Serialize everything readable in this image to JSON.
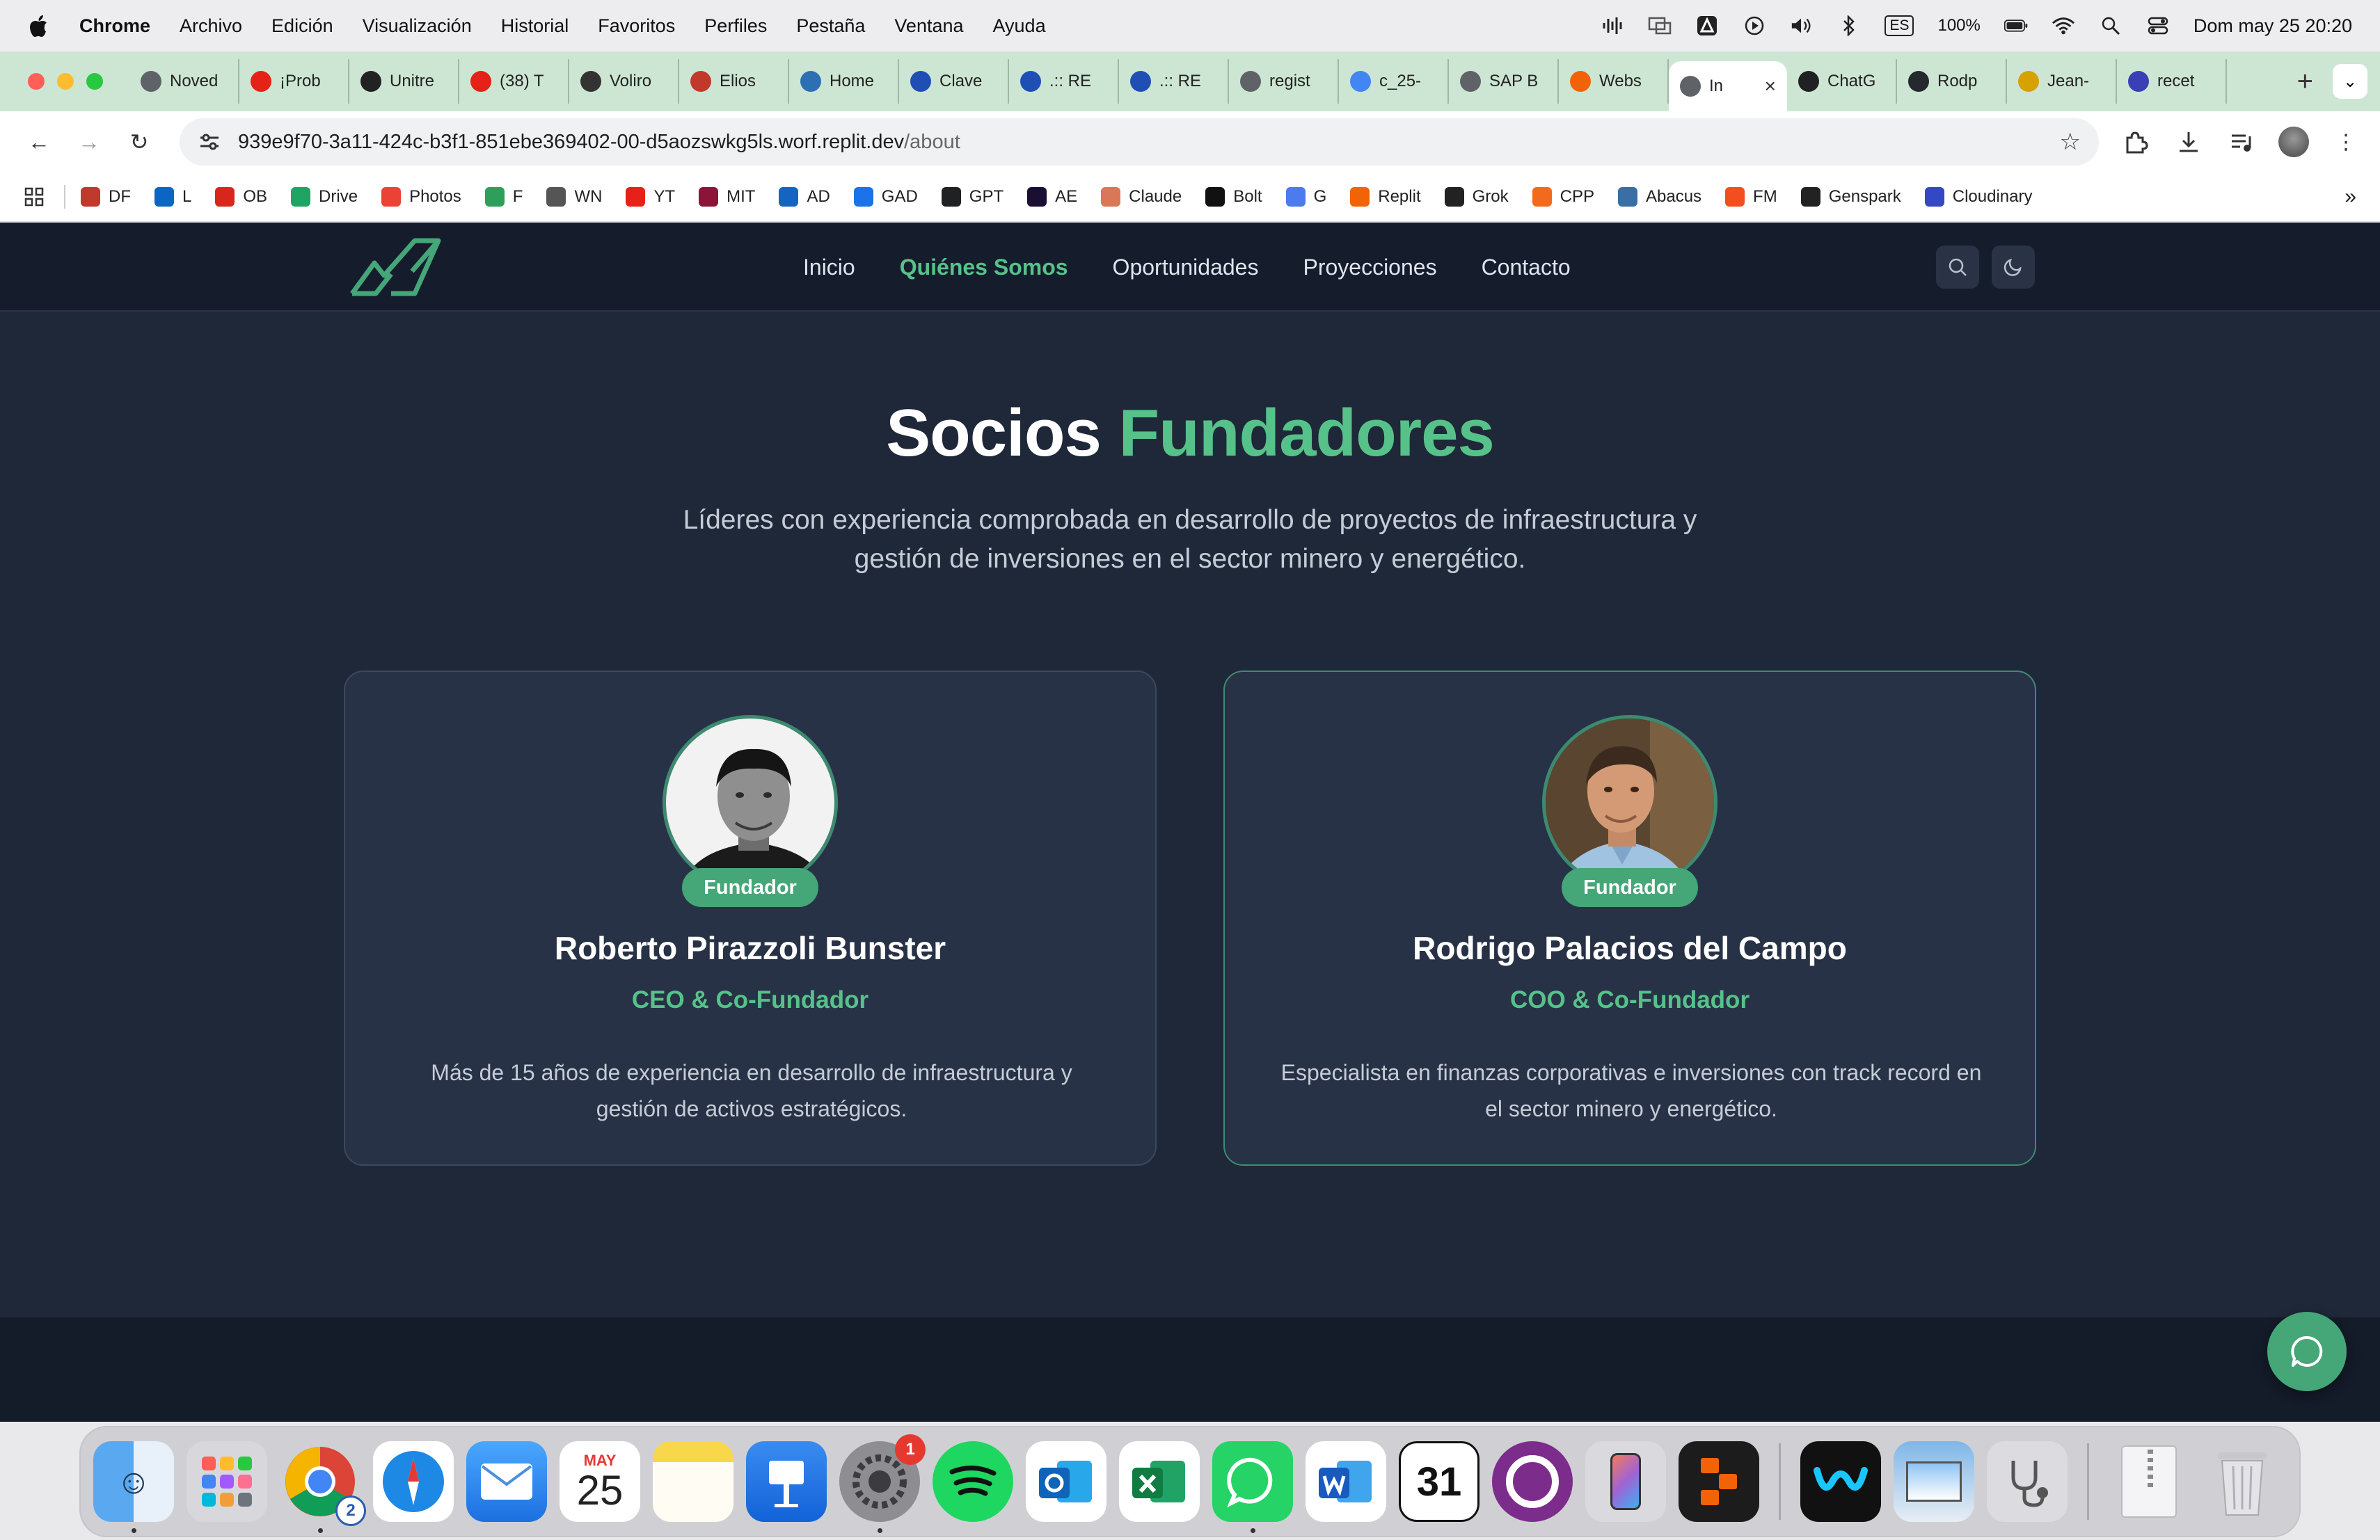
{
  "menubar": {
    "app_name": "Chrome",
    "menus": [
      "Archivo",
      "Edición",
      "Visualización",
      "Historial",
      "Favoritos",
      "Perfiles",
      "Pestaña",
      "Ventana",
      "Ayuda"
    ],
    "input_source": "ES",
    "battery": "100%",
    "datetime": "Dom may 25  20:20"
  },
  "tabs": [
    {
      "title": "Noved",
      "color": "#5f6368"
    },
    {
      "title": "¡Prob",
      "color": "#e62117"
    },
    {
      "title": "Unitre",
      "color": "#222222"
    },
    {
      "title": "(38) T",
      "color": "#e62117"
    },
    {
      "title": "Voliro",
      "color": "#333333"
    },
    {
      "title": "Elios",
      "color": "#c0392b"
    },
    {
      "title": "Home",
      "color": "#2c6fb3"
    },
    {
      "title": "Clave",
      "color": "#1f4fb5"
    },
    {
      "title": ".:: RE",
      "color": "#1f4fb5"
    },
    {
      "title": ".:: RE",
      "color": "#1f4fb5"
    },
    {
      "title": "regist",
      "color": "#5f6368"
    },
    {
      "title": "c_25-",
      "color": "#4285f4"
    },
    {
      "title": "SAP B",
      "color": "#5f6368"
    },
    {
      "title": "Webs",
      "color": "#f26207"
    },
    {
      "title": "In",
      "color": "#5f6368",
      "active": true
    },
    {
      "title": "ChatG",
      "color": "#202123"
    },
    {
      "title": "Rodp",
      "color": "#24292e"
    },
    {
      "title": "Jean-",
      "color": "#d7a100"
    },
    {
      "title": "recet",
      "color": "#3b3fb6"
    }
  ],
  "address": {
    "host": "939e9f70-3a11-424c-b3f1-851ebe369402-00-d5aozswkg5ls.worf.replit.dev",
    "path": "/about"
  },
  "bookmarks": [
    {
      "label": "DF",
      "color": "#c0392b"
    },
    {
      "label": "L",
      "color": "#0a66c2"
    },
    {
      "label": "OB",
      "color": "#d9261c"
    },
    {
      "label": "Drive",
      "color": "#1fa463"
    },
    {
      "label": "Photos",
      "color": "#ea4335"
    },
    {
      "label": "F",
      "color": "#2e9e5b"
    },
    {
      "label": "WN",
      "color": "#555555"
    },
    {
      "label": "YT",
      "color": "#e62117"
    },
    {
      "label": "MIT",
      "color": "#8a1538"
    },
    {
      "label": "AD",
      "color": "#1565c0"
    },
    {
      "label": "GAD",
      "color": "#1a73e8"
    },
    {
      "label": "GPT",
      "color": "#202123"
    },
    {
      "label": "AE",
      "color": "#1a0f33"
    },
    {
      "label": "Claude",
      "color": "#d97757"
    },
    {
      "label": "Bolt",
      "color": "#111111"
    },
    {
      "label": "G",
      "color": "#4b7bec"
    },
    {
      "label": "Replit",
      "color": "#f26207"
    },
    {
      "label": "Grok",
      "color": "#222222"
    },
    {
      "label": "CPP",
      "color": "#f26b1d"
    },
    {
      "label": "Abacus",
      "color": "#3a6ea5"
    },
    {
      "label": "FM",
      "color": "#f24e1e"
    },
    {
      "label": "Genspark",
      "color": "#222222"
    },
    {
      "label": "Cloudinary",
      "color": "#3448c5"
    }
  ],
  "site": {
    "nav": [
      "Inicio",
      "Quiénes Somos",
      "Oportunidades",
      "Proyecciones",
      "Contacto"
    ],
    "nav_active": "Quiénes Somos",
    "title_main": "Socios",
    "title_accent": "Fundadores",
    "subtitle": "Líderes con experiencia comprobada en desarrollo de proyectos de infraestructura y gestión de inversiones en el sector minero y energético.",
    "accent_color": "#56c28a",
    "founders": [
      {
        "badge": "Fundador",
        "name": "Roberto Pirazzoli Bunster",
        "role": "CEO & Co-Fundador",
        "bio": "Más de 15 años de experiencia en desarrollo de infraestructura y gestión de activos estratégicos."
      },
      {
        "badge": "Fundador",
        "name": "Rodrigo Palacios del Campo",
        "role": "COO & Co-Fundador",
        "bio": "Especialista en finanzas corporativas e inversiones con track record en el sector minero y energético."
      }
    ]
  },
  "dock": {
    "calendar_month": "MAY",
    "calendar_day": "25",
    "chrome_badge": "2",
    "settings_badge": "1",
    "ical_day": "31",
    "apps": [
      "finder",
      "launchpad",
      "chrome",
      "safari",
      "mail",
      "calendar",
      "notes",
      "keynote",
      "system-settings",
      "spotify",
      "outlook",
      "excel",
      "whatsapp",
      "word",
      "ical",
      "circle-app",
      "iphone-mirroring",
      "replit",
      "webex",
      "preview",
      "stethoscope-app",
      "zip-archive",
      "trash"
    ]
  }
}
